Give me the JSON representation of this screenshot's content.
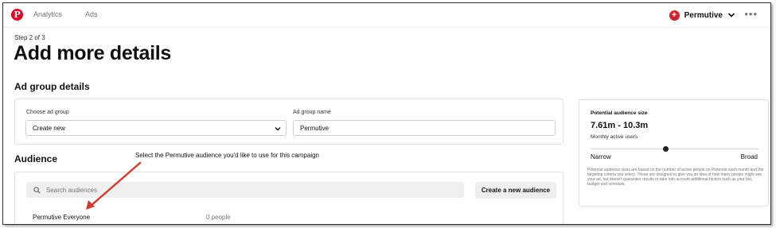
{
  "nav": {
    "logo": "P",
    "analytics": "Analytics",
    "ads": "Ads",
    "account_name": "Permutive",
    "account_icon": "+",
    "more": "•••"
  },
  "header": {
    "step": "Step 2 of 3",
    "title": "Add more details"
  },
  "ad_group": {
    "heading": "Ad group details",
    "choose_label": "Choose ad group",
    "choose_value": "Create new",
    "name_label": "Ad group name",
    "name_value": "Permutive"
  },
  "audience": {
    "heading": "Audience",
    "search_placeholder": "Search audiences",
    "create_button": "Create a new audience",
    "rows": [
      {
        "name": "Permutive Everyone",
        "count": "0 people"
      }
    ]
  },
  "potential": {
    "label": "Potential audience size",
    "range": "7.61m - 10.3m",
    "subtitle": "Monthly active users",
    "narrow": "Narrow",
    "broad": "Broad",
    "slider_position": 0.45,
    "disclaimer": "Potential audience sizes are based on the number of active people on Pinterest each month and the targeting criteria you select. These are designed to give you an idea of how many people might see your ad, but doesn't guarantee results or take into account additional factors such as your bid, budget and schedule."
  },
  "annotation": {
    "text": "Select the Permutive audience you'd like to use for this campaign",
    "color": "#d9372b"
  },
  "colors": {
    "brand_red": "#e60023",
    "surface_gray": "#efefef"
  }
}
